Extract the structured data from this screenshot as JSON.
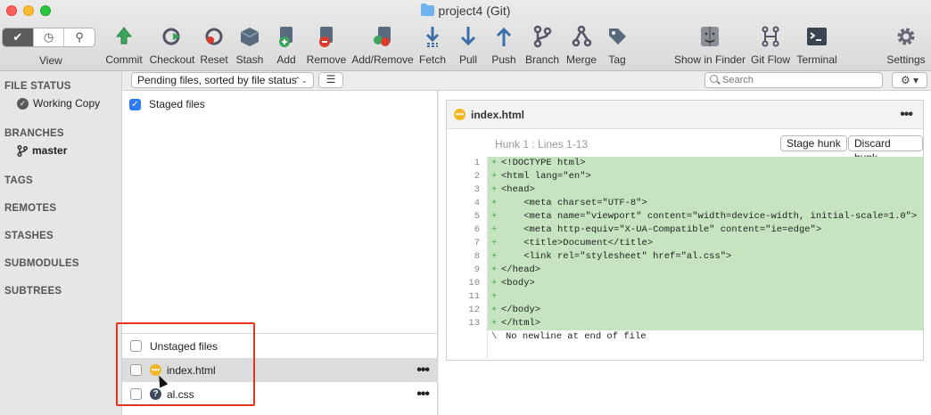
{
  "window": {
    "title": "project4 (Git)"
  },
  "toolbar": {
    "view_label": "View",
    "items": [
      {
        "label": "Commit",
        "icon": "commit-icon"
      },
      {
        "label": "Checkout",
        "icon": "checkout-icon"
      },
      {
        "label": "Reset",
        "icon": "reset-icon"
      },
      {
        "label": "Stash",
        "icon": "stash-icon"
      },
      {
        "label": "Add",
        "icon": "add-icon"
      },
      {
        "label": "Remove",
        "icon": "remove-icon"
      },
      {
        "label": "Add/Remove",
        "icon": "add-remove-icon"
      },
      {
        "label": "Fetch",
        "icon": "fetch-icon"
      },
      {
        "label": "Pull",
        "icon": "pull-icon"
      },
      {
        "label": "Push",
        "icon": "push-icon"
      },
      {
        "label": "Branch",
        "icon": "branch-icon"
      },
      {
        "label": "Merge",
        "icon": "merge-icon"
      },
      {
        "label": "Tag",
        "icon": "tag-icon"
      },
      {
        "label": "Show in Finder",
        "icon": "finder-icon"
      },
      {
        "label": "Git Flow",
        "icon": "git-flow-icon"
      },
      {
        "label": "Terminal",
        "icon": "terminal-icon"
      },
      {
        "label": "Settings",
        "icon": "gear-icon"
      }
    ]
  },
  "sidebar": {
    "file_status": "FILE STATUS",
    "working_copy": "Working Copy",
    "branches": "BRANCHES",
    "master": "master",
    "tags": "TAGS",
    "remotes": "REMOTES",
    "stashes": "STASHES",
    "submodules": "SUBMODULES",
    "subtrees": "SUBTREES"
  },
  "filter": {
    "sort_label": "Pending files, sorted by file status",
    "search_placeholder": "Search"
  },
  "staged": {
    "label": "Staged files"
  },
  "unstaged": {
    "label": "Unstaged files",
    "files": [
      {
        "name": "index.html",
        "status": "modified"
      },
      {
        "name": "al.css",
        "status": "untracked"
      }
    ]
  },
  "diff": {
    "filename": "index.html",
    "hunk_title": "Hunk 1 : Lines 1-13",
    "stage_hunk": "Stage hunk",
    "discard_hunk": "Discard hunk",
    "lines": [
      {
        "n": "1",
        "text": "<!DOCTYPE html>"
      },
      {
        "n": "2",
        "text": "<html lang=\"en\">"
      },
      {
        "n": "3",
        "text": "<head>"
      },
      {
        "n": "4",
        "text": "    <meta charset=\"UTF-8\">"
      },
      {
        "n": "5",
        "text": "    <meta name=\"viewport\" content=\"width=device-width, initial-scale=1.0\">"
      },
      {
        "n": "6",
        "text": "    <meta http-equiv=\"X-UA-Compatible\" content=\"ie=edge\">"
      },
      {
        "n": "7",
        "text": "    <title>Document</title>"
      },
      {
        "n": "8",
        "text": "    <link rel=\"stylesheet\" href=\"al.css\">"
      },
      {
        "n": "9",
        "text": "</head>"
      },
      {
        "n": "10",
        "text": "<body>"
      },
      {
        "n": "11",
        "text": ""
      },
      {
        "n": "12",
        "text": "</body>"
      },
      {
        "n": "13",
        "text": "</html>"
      }
    ],
    "no_newline": "No newline at end of file"
  },
  "colors": {
    "added_line": "#c6e4bf",
    "accent": "#2f7bf5",
    "annotation": "#e5351d"
  }
}
